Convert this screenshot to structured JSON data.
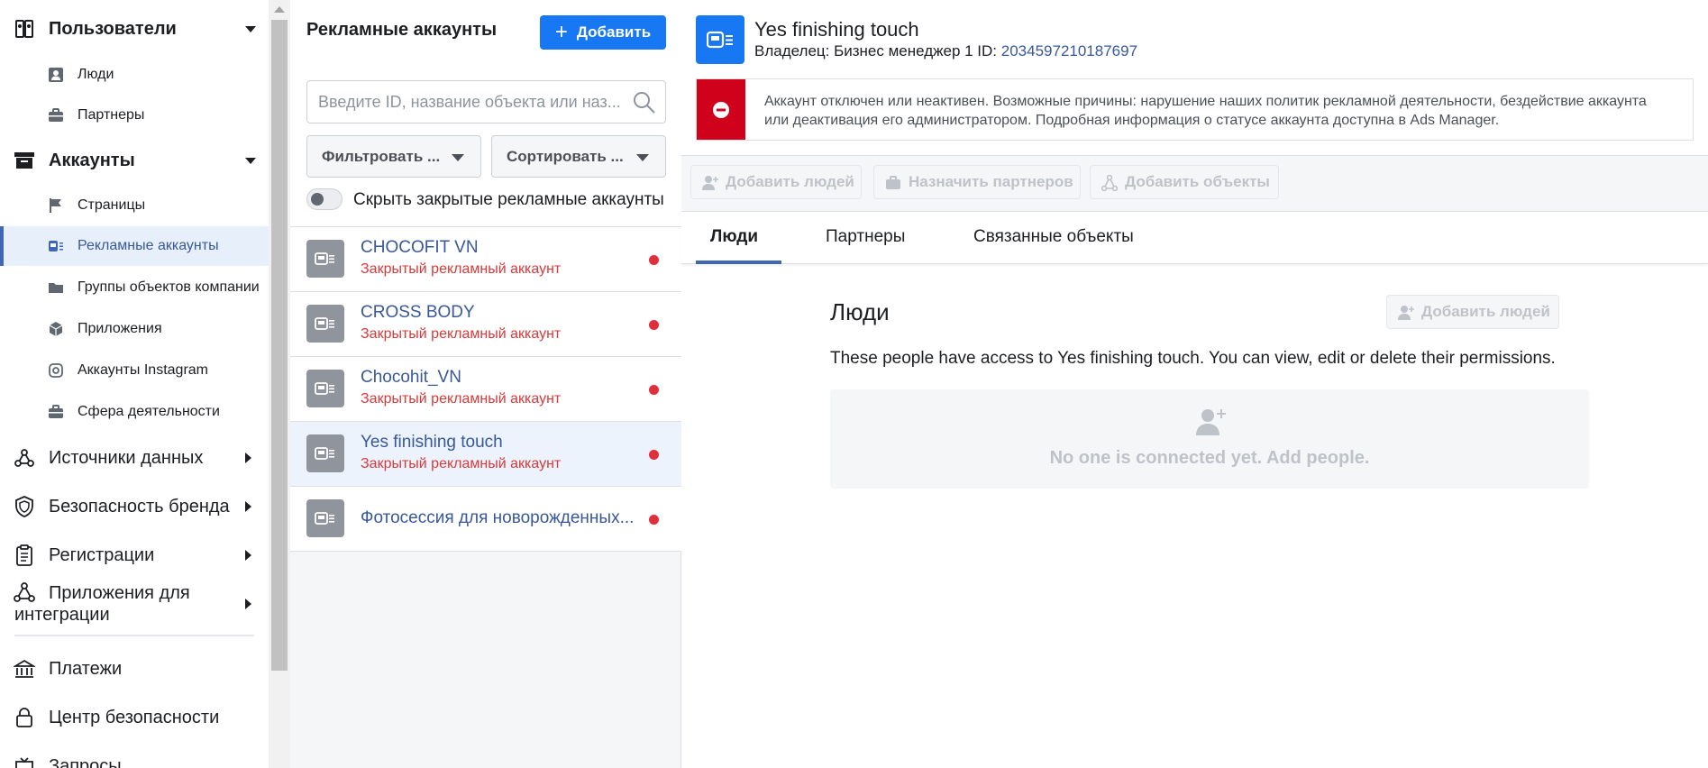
{
  "sidebar": {
    "users": {
      "label": "Пользователи",
      "items": [
        "Люди",
        "Партнеры"
      ]
    },
    "accounts": {
      "label": "Аккаунты",
      "items": [
        "Страницы",
        "Рекламные аккаунты",
        "Группы объектов компании",
        "Приложения",
        "Аккаунты Instagram",
        "Сфера деятельности"
      ]
    },
    "data_sources": "Источники данных",
    "brand_safety": "Безопасность бренда",
    "registrations": "Регистрации",
    "integrations": "Приложения для интеграции",
    "payments": "Платежи",
    "security_center": "Центр безопасности",
    "requests": "Запросы"
  },
  "list": {
    "title": "Рекламные аккаунты",
    "add_label": "Добавить",
    "search_placeholder": "Введите ID, название объекта или наз...",
    "filter_label": "Фильтровать ...",
    "sort_label": "Сортировать ...",
    "hide_closed_label": "Скрыть закрытые рекламные аккаунты",
    "accounts": [
      {
        "name": "CHOCOFIT VN",
        "status": "Закрытый рекламный аккаунт"
      },
      {
        "name": "CROSS BODY",
        "status": "Закрытый рекламный аккаунт"
      },
      {
        "name": "Chocohit_VN",
        "status": "Закрытый рекламный аккаунт"
      },
      {
        "name": "Yes finishing touch",
        "status": "Закрытый рекламный аккаунт"
      },
      {
        "name": "Фотосессия для новорожденных...",
        "status": ""
      }
    ],
    "selected_index": 3
  },
  "detail": {
    "title": "Yes finishing touch",
    "owner_prefix": "Владелец: Бизнес менеджер 1  ID:",
    "owner_id": "2034597210187697",
    "alert_text": "Аккаунт отключен или неактивен. Возможные причины: нарушение наших политик рекламной деятельности, бездействие аккаунта или деактивация его администратором. Подробная информация о статусе аккаунта доступна в Ads Manager.",
    "actions": [
      "Добавить людей",
      "Назначить партнеров",
      "Добавить объекты"
    ],
    "tabs": [
      "Люди",
      "Партнеры",
      "Связанные объекты"
    ],
    "people": {
      "title": "Люди",
      "add_label": "Добавить людей",
      "description": "These people have access to Yes finishing touch. You can view, edit or delete their permissions.",
      "empty_text": "No one is connected yet. Add people."
    }
  },
  "colors": {
    "primary": "#1877f2",
    "link": "#385898",
    "danger": "#d0021b",
    "closed_text": "#d93a3a"
  }
}
